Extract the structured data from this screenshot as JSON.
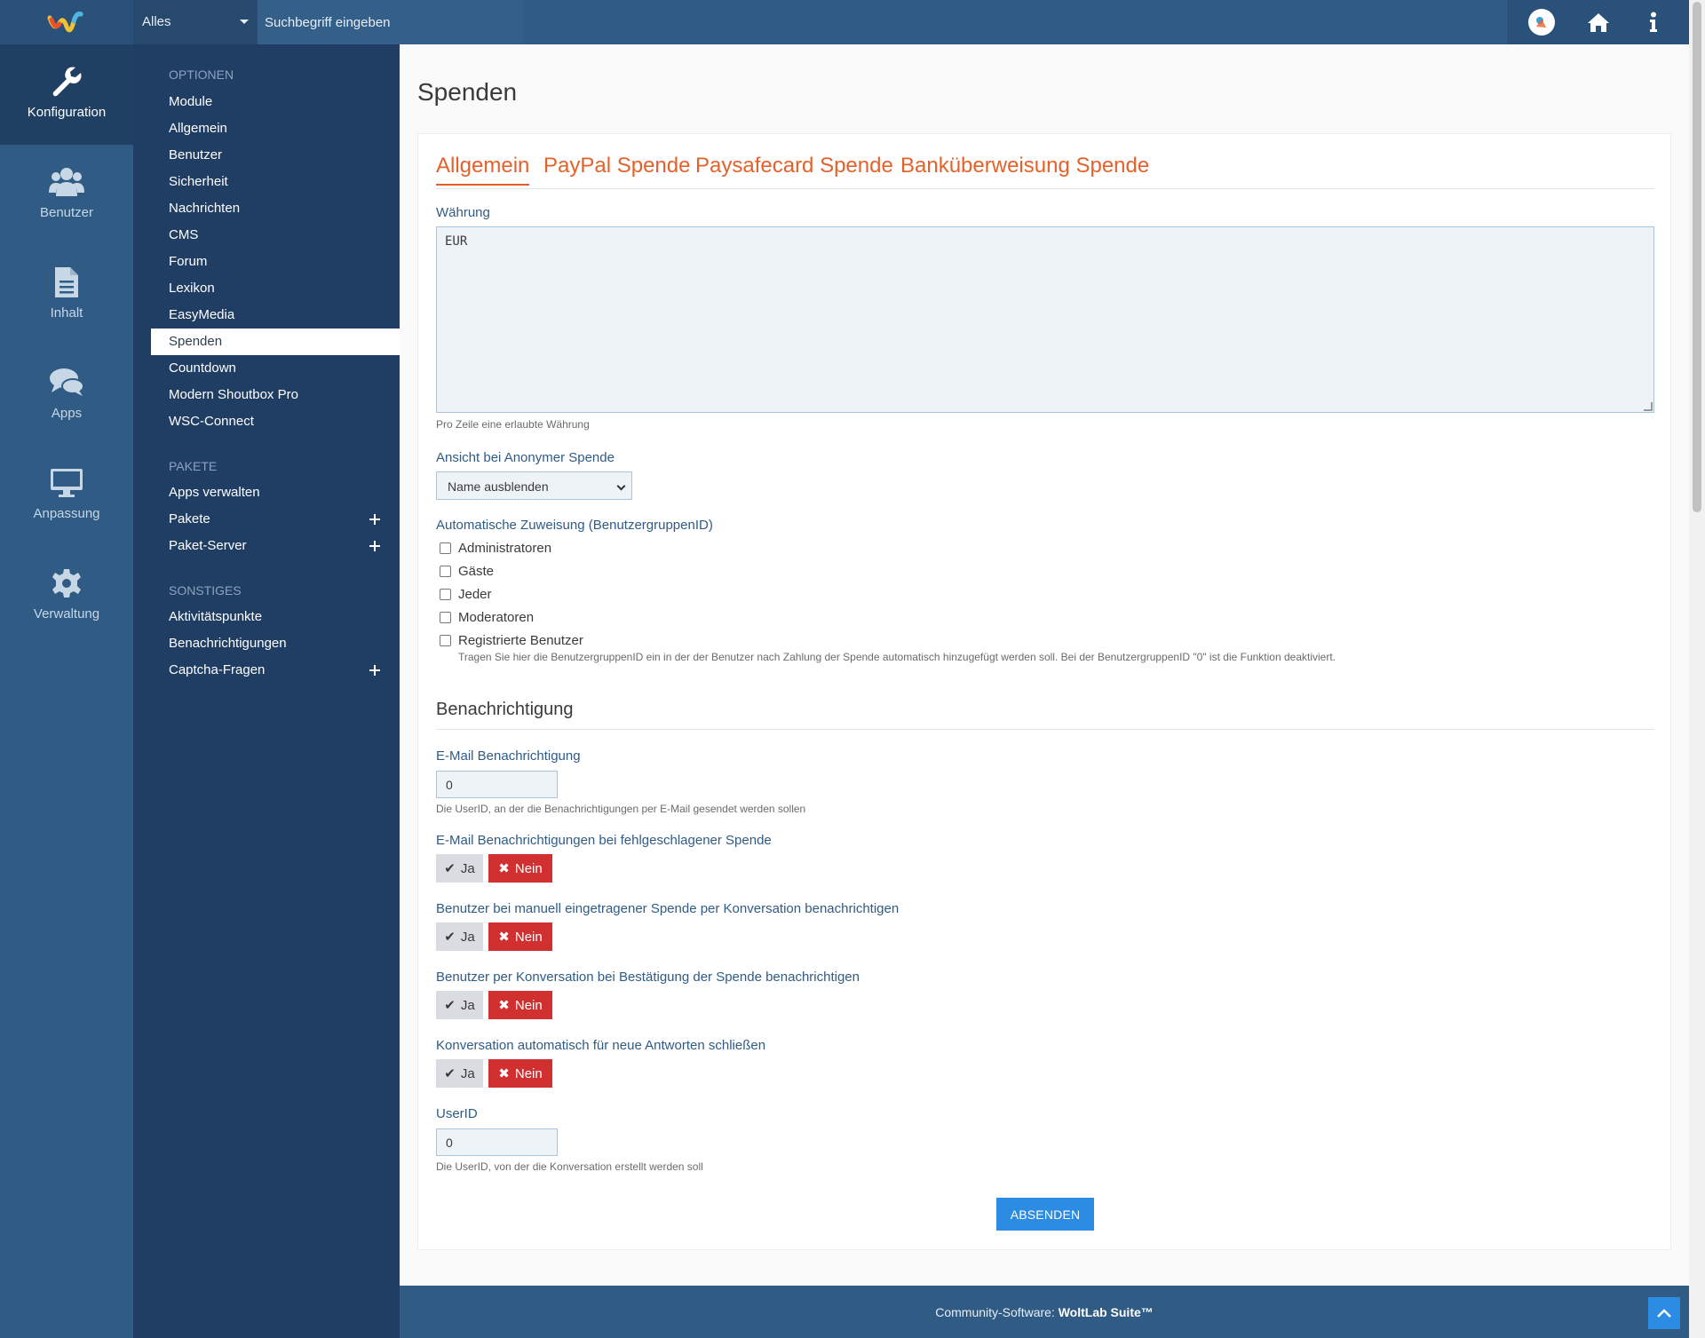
{
  "header": {
    "search_scope": "Alles",
    "search_placeholder": "Suchbegriff eingeben"
  },
  "rail": [
    {
      "label": "Konfiguration",
      "icon": "wrench-icon"
    },
    {
      "label": "Benutzer",
      "icon": "users-icon"
    },
    {
      "label": "Inhalt",
      "icon": "document-icon"
    },
    {
      "label": "Apps",
      "icon": "chat-icon"
    },
    {
      "label": "Anpassung",
      "icon": "monitor-icon"
    },
    {
      "label": "Verwaltung",
      "icon": "gear-icon"
    }
  ],
  "submenu": {
    "options_heading": "OPTIONEN",
    "options": [
      "Module",
      "Allgemein",
      "Benutzer",
      "Sicherheit",
      "Nachrichten",
      "CMS",
      "Forum",
      "Lexikon",
      "EasyMedia",
      "Spenden",
      "Countdown",
      "Modern Shoutbox Pro",
      "WSC-Connect"
    ],
    "packages_heading": "PAKETE",
    "packages": [
      "Apps verwalten",
      "Pakete",
      "Paket-Server"
    ],
    "misc_heading": "SONSTIGES",
    "misc": [
      "Aktivitätspunkte",
      "Benachrichtigungen",
      "Captcha-Fragen"
    ]
  },
  "page": {
    "title": "Spenden",
    "tabs": [
      "Allgemein",
      "PayPal Spende",
      "Paysafecard Spende",
      "Banküberweisung Spende"
    ],
    "currency_label": "Währung",
    "currency_value": "EUR",
    "currency_desc": "Pro Zeile eine erlaubte Währung",
    "anon_label": "Ansicht bei Anonymer Spende",
    "anon_value": "Name ausblenden",
    "auto_label": "Automatische Zuweisung (BenutzergruppenID)",
    "groups": [
      "Administratoren",
      "Gäste",
      "Jeder",
      "Moderatoren",
      "Registrierte Benutzer"
    ],
    "auto_desc": "Tragen Sie hier die BenutzergruppenID ein in der der Benutzer nach Zahlung der Spende automatisch hinzugefügt werden soll. Bei der BenutzergruppenID \"0\" ist die Funktion deaktiviert.",
    "section_title": "Benachrichtigung",
    "email_label": "E-Mail Benachrichtigung",
    "email_value": "0",
    "email_desc": "Die UserID, an der die Benachrichtigungen per E-Mail gesendet werden sollen",
    "toggles": [
      "E-Mail Benachrichtigungen bei fehlgeschlagener Spende",
      "Benutzer bei manuell eingetragener Spende per Konversation benachrichtigen",
      "Benutzer per Konversation bei Bestätigung der Spende benachrichtigen",
      "Konversation automatisch für neue Antworten schließen"
    ],
    "yes_label": "Ja",
    "no_label": "Nein",
    "userid_label": "UserID",
    "userid_value": "0",
    "userid_desc": "Die UserID, von der die Konversation erstellt werden soll",
    "submit_label": "ABSENDEN"
  },
  "footer": {
    "prefix": "Community-Software: ",
    "brand": "WoltLab Suite™"
  },
  "colors": {
    "header": "#2f5b85",
    "submenu": "#203e63",
    "accent_orange": "#e6612a",
    "no_button": "#d0302f",
    "submit": "#2c8be3"
  }
}
